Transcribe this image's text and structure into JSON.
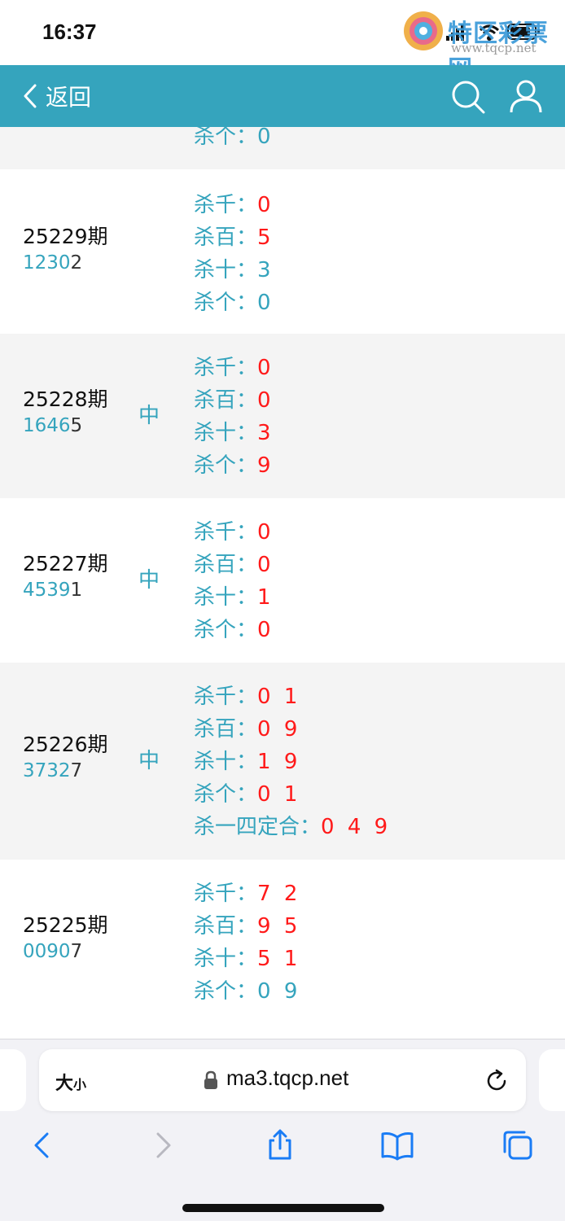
{
  "status_bar": {
    "time": "16:37",
    "watermark_text": "特区彩票网",
    "watermark_url": "www.tqcp.net"
  },
  "nav": {
    "back_label": "返回",
    "back_icon": "chevron-left-icon",
    "search_icon": "search-icon",
    "user_icon": "user-icon"
  },
  "colors": {
    "accent": "#35a4bd",
    "kill_red": "#ff1a1a",
    "row_gray": "#f4f4f4"
  },
  "partial_row": {
    "label": "杀个：",
    "value": "0",
    "value_color": "blue"
  },
  "records": [
    {
      "period": "25229期",
      "draw_highlight": "1230",
      "draw_last": "2",
      "hit": "",
      "kills": [
        {
          "label": "杀千：",
          "value": "0",
          "color": "red"
        },
        {
          "label": "杀百：",
          "value": "5",
          "color": "red"
        },
        {
          "label": "杀十：",
          "value": "3",
          "color": "blue"
        },
        {
          "label": "杀个：",
          "value": "0",
          "color": "blue"
        }
      ]
    },
    {
      "period": "25228期",
      "draw_highlight": "1646",
      "draw_last": "5",
      "hit": "中",
      "kills": [
        {
          "label": "杀千：",
          "value": "0",
          "color": "red"
        },
        {
          "label": "杀百：",
          "value": "0",
          "color": "red"
        },
        {
          "label": "杀十：",
          "value": "3",
          "color": "red"
        },
        {
          "label": "杀个：",
          "value": "9",
          "color": "red"
        }
      ]
    },
    {
      "period": "25227期",
      "draw_highlight": "4539",
      "draw_last": "1",
      "hit": "中",
      "kills": [
        {
          "label": "杀千：",
          "value": "0",
          "color": "red"
        },
        {
          "label": "杀百：",
          "value": "0",
          "color": "red"
        },
        {
          "label": "杀十：",
          "value": "1",
          "color": "red"
        },
        {
          "label": "杀个：",
          "value": "0",
          "color": "red"
        }
      ]
    },
    {
      "period": "25226期",
      "draw_highlight": "3732",
      "draw_last": "7",
      "hit": "中",
      "kills": [
        {
          "label": "杀千：",
          "value": "0 1",
          "color": "red"
        },
        {
          "label": "杀百：",
          "value": "0 9",
          "color": "red"
        },
        {
          "label": "杀十：",
          "value": "1 9",
          "color": "red"
        },
        {
          "label": "杀个：",
          "value": "0 1",
          "color": "red"
        },
        {
          "label": "杀一四定合：",
          "value": "0 4 9",
          "color": "red"
        }
      ]
    },
    {
      "period": "25225期",
      "draw_highlight": "0090",
      "draw_last": "7",
      "hit": "",
      "kills": [
        {
          "label": "杀千：",
          "value": "7 2",
          "color": "red"
        },
        {
          "label": "杀百：",
          "value": "9 5",
          "color": "red"
        },
        {
          "label": "杀十：",
          "value": "5 1",
          "color": "red"
        },
        {
          "label": "杀个：",
          "value": "0 9",
          "color": "blue"
        }
      ]
    }
  ],
  "browser": {
    "text_size_big": "大",
    "text_size_small": "小",
    "url": "ma3.tqcp.net",
    "lock_icon": "lock-icon",
    "reload_icon": "reload-icon",
    "toolbar": [
      "back-icon",
      "forward-icon",
      "share-icon",
      "bookmarks-icon",
      "tabs-icon"
    ]
  }
}
